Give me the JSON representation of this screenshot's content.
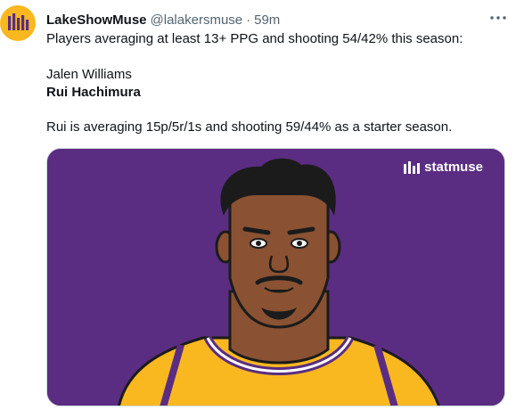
{
  "tweet": {
    "display_name": "LakeShowMuse",
    "handle": "@lalakersmuse",
    "separator": "·",
    "time": "59m",
    "lines": [
      "Players averaging at least 13+ PPG and shooting 54/42% this season:",
      "Jalen Williams",
      "Rui Hachimura",
      "Rui is averaging 15p/5r/1s and shooting 59/44% as a starter season."
    ]
  },
  "media": {
    "brand_label": "statmuse",
    "background_color": "#5a2d82",
    "jersey_color": "#f9b820"
  },
  "icons": {
    "avatar": "lakeshowmuse-logo",
    "more": "more-options-icon",
    "brand": "statmuse-logo-icon"
  },
  "colors": {
    "avatar_bg": "#f9b820",
    "text_primary": "#0f1419",
    "text_secondary": "#536471"
  }
}
